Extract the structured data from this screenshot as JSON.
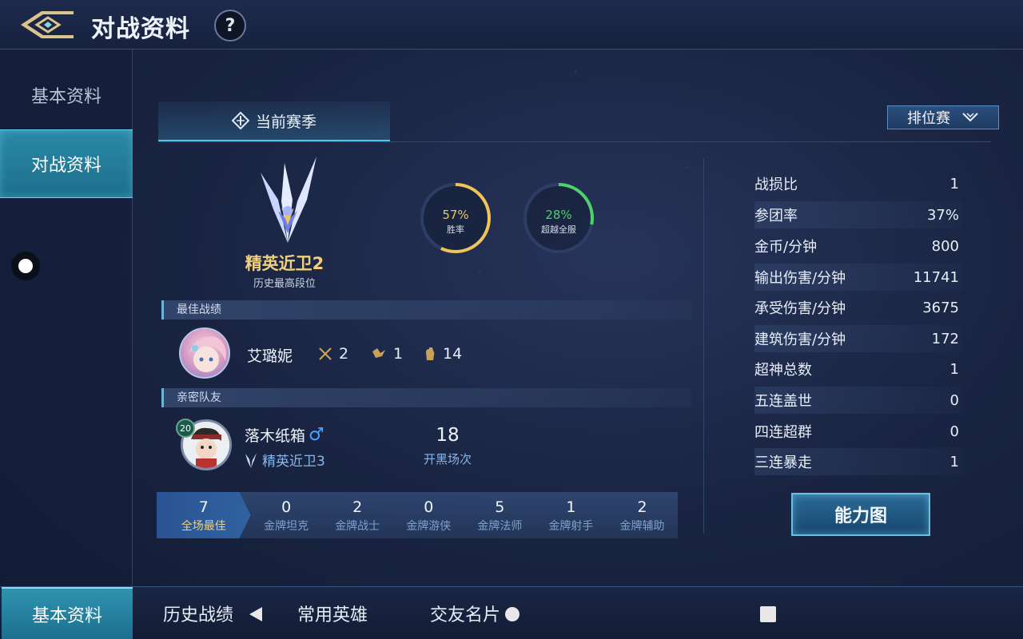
{
  "header": {
    "title": "对战资料",
    "help_label": "?"
  },
  "sidebar": {
    "items": [
      {
        "label": "基本资料"
      },
      {
        "label": "对战资料"
      }
    ]
  },
  "season": {
    "tab_label": "当前赛季",
    "mode_label": "排位赛"
  },
  "rank": {
    "name": "精英近卫2",
    "subtitle": "历史最高段位"
  },
  "rings": [
    {
      "value": "57%",
      "label": "胜率",
      "fraction": 0.57,
      "color": "#f1c45a"
    },
    {
      "value": "28%",
      "label": "超越全服",
      "fraction": 0.28,
      "color": "#4fd16a"
    }
  ],
  "best_record": {
    "section_title": "最佳战绩",
    "hero_name": "艾璐妮",
    "kills": "2",
    "deaths": "1",
    "assists": "14"
  },
  "teammate": {
    "section_title": "亲密队友",
    "level": "20",
    "name": "落木纸箱",
    "gender_symbol": "♂",
    "rank": "精英近卫3",
    "count": "18",
    "count_label": "开黑场次"
  },
  "medals": [
    {
      "value": "7",
      "label": "全场最佳"
    },
    {
      "value": "0",
      "label": "金牌坦克"
    },
    {
      "value": "2",
      "label": "金牌战士"
    },
    {
      "value": "0",
      "label": "金牌游侠"
    },
    {
      "value": "5",
      "label": "金牌法师"
    },
    {
      "value": "1",
      "label": "金牌射手"
    },
    {
      "value": "2",
      "label": "金牌辅助"
    }
  ],
  "stats": [
    {
      "label": "战损比",
      "value": "1"
    },
    {
      "label": "参团率",
      "value": "37%"
    },
    {
      "label": "金币/分钟",
      "value": "800"
    },
    {
      "label": "输出伤害/分钟",
      "value": "11741"
    },
    {
      "label": "承受伤害/分钟",
      "value": "3675"
    },
    {
      "label": "建筑伤害/分钟",
      "value": "172"
    },
    {
      "label": "超神总数",
      "value": "1"
    },
    {
      "label": "五连盖世",
      "value": "0"
    },
    {
      "label": "四连超群",
      "value": "0"
    },
    {
      "label": "三连暴走",
      "value": "1"
    }
  ],
  "ability_button": "能力图",
  "bottom_nav": [
    {
      "label": "基本资料"
    },
    {
      "label": "历史战绩"
    },
    {
      "label": "常用英雄"
    },
    {
      "label": "交友名片"
    }
  ]
}
